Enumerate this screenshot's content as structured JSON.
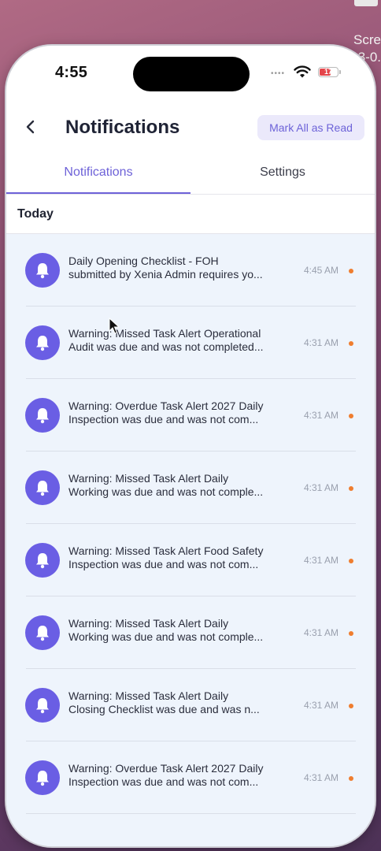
{
  "desktop": {
    "text_line1": "Scre",
    "text_line2": "3-0."
  },
  "status_bar": {
    "time": "4:55",
    "battery": "17"
  },
  "header": {
    "title": "Notifications",
    "mark_all_label": "Mark All as Read"
  },
  "tabs": [
    {
      "label": "Notifications",
      "active": true
    },
    {
      "label": "Settings",
      "active": false
    }
  ],
  "section": {
    "label": "Today"
  },
  "notifications": [
    {
      "line1": "Daily Opening Checklist - FOH",
      "line2": "submitted by Xenia Admin requires yo...",
      "time": "4:45 AM",
      "unread": true
    },
    {
      "line1": "Warning: Missed Task Alert Operational",
      "line2": "Audit  was due and was not completed...",
      "time": "4:31 AM",
      "unread": true
    },
    {
      "line1": "Warning: Overdue Task Alert 2027 Daily",
      "line2": "Inspection  was due and was not com...",
      "time": "4:31 AM",
      "unread": true
    },
    {
      "line1": "Warning: Missed Task Alert Daily",
      "line2": "Working  was due and was not comple...",
      "time": "4:31 AM",
      "unread": true
    },
    {
      "line1": "Warning: Missed Task Alert Food Safety",
      "line2": "Inspection  was due and was not com...",
      "time": "4:31 AM",
      "unread": true
    },
    {
      "line1": "Warning: Missed Task Alert Daily",
      "line2": "Working  was due and was not comple...",
      "time": "4:31 AM",
      "unread": true
    },
    {
      "line1": "Warning: Missed Task Alert Daily",
      "line2": "Closing Checklist  was due and was n...",
      "time": "4:31 AM",
      "unread": true
    },
    {
      "line1": "Warning: Overdue Task Alert 2027 Daily",
      "line2": "Inspection  was due and was not com...",
      "time": "4:31 AM",
      "unread": true
    }
  ],
  "colors": {
    "accent": "#6e62d8",
    "unread_dot": "#ef7d2f",
    "list_bg": "#eef4fc"
  }
}
